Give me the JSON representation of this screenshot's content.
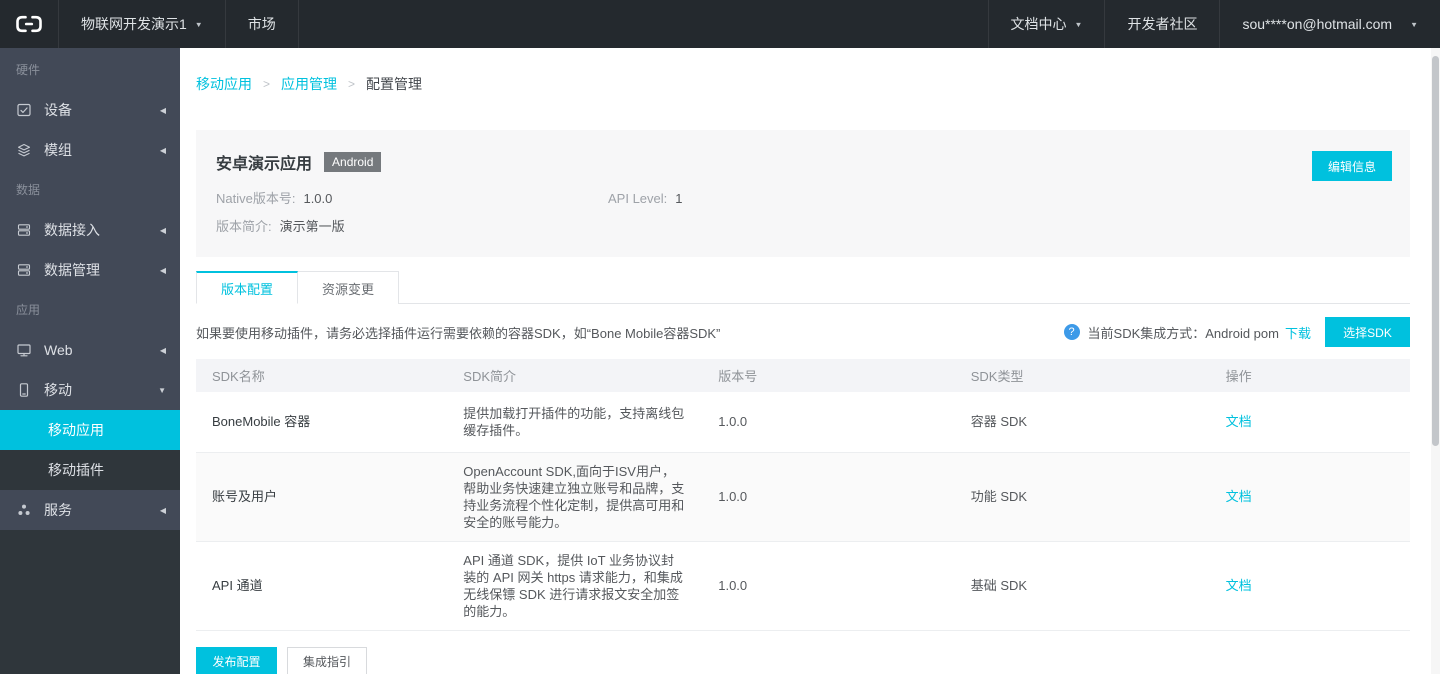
{
  "colors": {
    "accent": "#00c1de",
    "topbar_bg": "#24292e",
    "sidebar_bg": "#424957",
    "sidebar_dark_bg": "#2f363b",
    "card_bg": "#f7f7f8",
    "table_header_bg": "#f3f4f7",
    "row_alt_bg": "#fafafa",
    "badge_bg": "#75797d",
    "help_icon_bg": "#3d9ae8"
  },
  "icons": {
    "dropdown_caret": "▼",
    "collapse_arrow": "◀",
    "expand_arrow": "▼",
    "breadcrumb_separator": ">",
    "help_glyph": "?"
  },
  "topbar": {
    "project_name": "物联网开发演示1",
    "market": "市场",
    "doc_center": "文档中心",
    "community": "开发者社区",
    "account": "sou****on@hotmail.com"
  },
  "sidebar": {
    "sections": [
      {
        "label": "硬件",
        "items": [
          {
            "label": "设备"
          },
          {
            "label": "模组"
          }
        ]
      },
      {
        "label": "数据",
        "items": [
          {
            "label": "数据接入"
          },
          {
            "label": "数据管理"
          }
        ]
      },
      {
        "label": "应用",
        "items": [
          {
            "label": "Web"
          },
          {
            "label": "移动",
            "expanded": true,
            "children": [
              {
                "label": "移动应用",
                "active": true
              },
              {
                "label": "移动插件"
              }
            ]
          },
          {
            "label": "服务"
          }
        ]
      }
    ]
  },
  "breadcrumb": {
    "items": [
      "移动应用",
      "应用管理",
      "配置管理"
    ]
  },
  "app_card": {
    "title": "安卓演示应用",
    "platform_badge": "Android",
    "edit_button": "编辑信息",
    "native_version_label": "Native版本号:",
    "native_version": "1.0.0",
    "api_level_label": "API Level:",
    "api_level": "1",
    "version_desc_label": "版本简介:",
    "version_desc": "演示第一版"
  },
  "tabs": {
    "version_config": "版本配置",
    "resource_change": "资源变更",
    "active": "版本配置"
  },
  "sdk_section": {
    "note": "如果要使用移动插件，请务必选择插件运行需要依赖的容器SDK，如“Bone Mobile容器SDK”",
    "integration_label": "当前SDK集成方式：Android pom",
    "download_link": "下载",
    "select_sdk_button": "选择SDK"
  },
  "table": {
    "headers": [
      "SDK名称",
      "SDK简介",
      "版本号",
      "SDK类型",
      "操作"
    ],
    "rows": [
      {
        "name": "BoneMobile 容器",
        "desc": "提供加载打开插件的功能，支持离线包缓存插件。",
        "version": "1.0.0",
        "type": "容器 SDK",
        "action": "文档"
      },
      {
        "name": "账号及用户",
        "desc": "OpenAccount SDK,面向于ISV用户，帮助业务快速建立独立账号和品牌，支持业务流程个性化定制，提供高可用和安全的账号能力。",
        "version": "1.0.0",
        "type": "功能 SDK",
        "action": "文档"
      },
      {
        "name": "API 通道",
        "desc": "API 通道 SDK，提供 IoT 业务协议封装的 API 网关 https 请求能力，和集成无线保镖 SDK 进行请求报文安全加签的能力。",
        "version": "1.0.0",
        "type": "基础 SDK",
        "action": "文档"
      }
    ]
  },
  "footer": {
    "publish_button": "发布配置",
    "guide_button": "集成指引"
  }
}
